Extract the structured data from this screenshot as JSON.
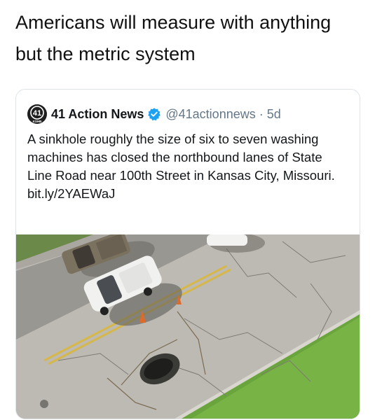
{
  "caption": {
    "line1": "Americans will measure with anything",
    "line2": "but the metric system"
  },
  "tweet": {
    "account_name": "41 Action News",
    "logo_label": "41",
    "logo_sub": "KSHB",
    "verified_icon": "verified-badge-icon",
    "handle": "@41actionnews",
    "separator": "·",
    "time": "5d",
    "text": "A sinkhole roughly the size of six to seven washing machines has closed the northbound lanes of State Line Road near 100th Street in Kansas City, Missouri.",
    "link": "bit.ly/2YAEWaJ",
    "image": "aerial-photo-sinkhole-road"
  },
  "colors": {
    "name": "#14171a",
    "secondary": "#657786",
    "verified": "#1da1f2",
    "border": "#dfe3e8"
  }
}
